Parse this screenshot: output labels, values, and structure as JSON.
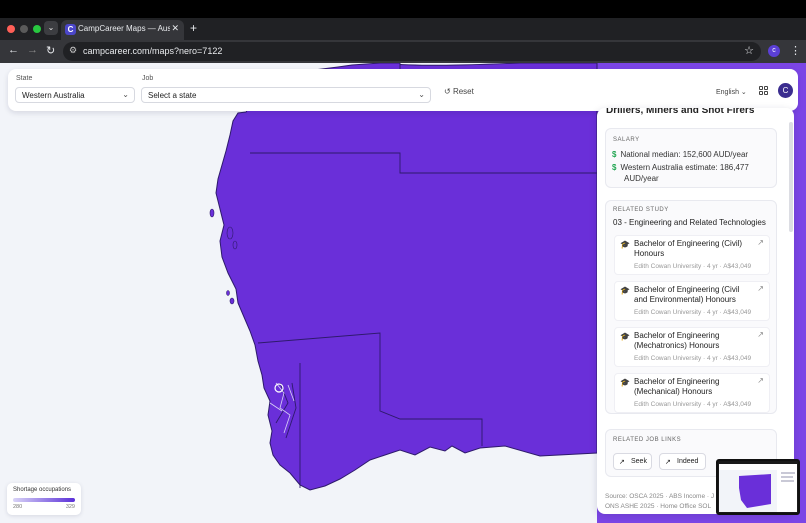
{
  "browser": {
    "tab_title": "CampCareer Maps — Australia",
    "tab_favicon": "C",
    "url": "campcareer.com/maps?nero=7122",
    "profile_initial": "c"
  },
  "filters": {
    "state_label": "State",
    "state_value": "Western Australia",
    "job_label": "Job",
    "job_value": "Select a state",
    "reset_label": "Reset",
    "language": "English",
    "user_initial": "C"
  },
  "panel": {
    "title": "Drillers, Miners and Shot Firers",
    "salary": {
      "heading": "SALARY",
      "national": "National median: 152,600 AUD/year",
      "state_line1": "Western Australia estimate: 186,477",
      "state_line2": "AUD/year"
    },
    "study": {
      "heading": "RELATED STUDY",
      "field": "03 - Engineering and Related Technologies",
      "courses": [
        {
          "title": "Bachelor of Engineering (Civil) Honours",
          "meta": "Edith Cowan University · 4 yr · A$43,049"
        },
        {
          "title": "Bachelor of Engineering (Civil and Environmental) Honours",
          "meta": "Edith Cowan University · 4 yr · A$43,049"
        },
        {
          "title": "Bachelor of Engineering (Mechatronics) Honours",
          "meta": "Edith Cowan University · 4 yr · A$43,049"
        },
        {
          "title": "Bachelor of Engineering (Mechanical) Honours",
          "meta": "Edith Cowan University · 4 yr · A$43,049"
        }
      ]
    },
    "jobs": {
      "heading": "RELATED JOB LINKS",
      "links": [
        "Seek",
        "Indeed"
      ]
    },
    "source_line1": "Source: OSCA 2025 · ABS Income · J",
    "source_line2": "ONS ASHE 2025 · Home Office SOL"
  },
  "legend": {
    "title": "Shortage occupations",
    "min": "280",
    "max": "329"
  },
  "colors": {
    "map_fill": "#6a2fd9",
    "map_stroke": "#2e1a6b",
    "accent": "#4b46c8"
  }
}
